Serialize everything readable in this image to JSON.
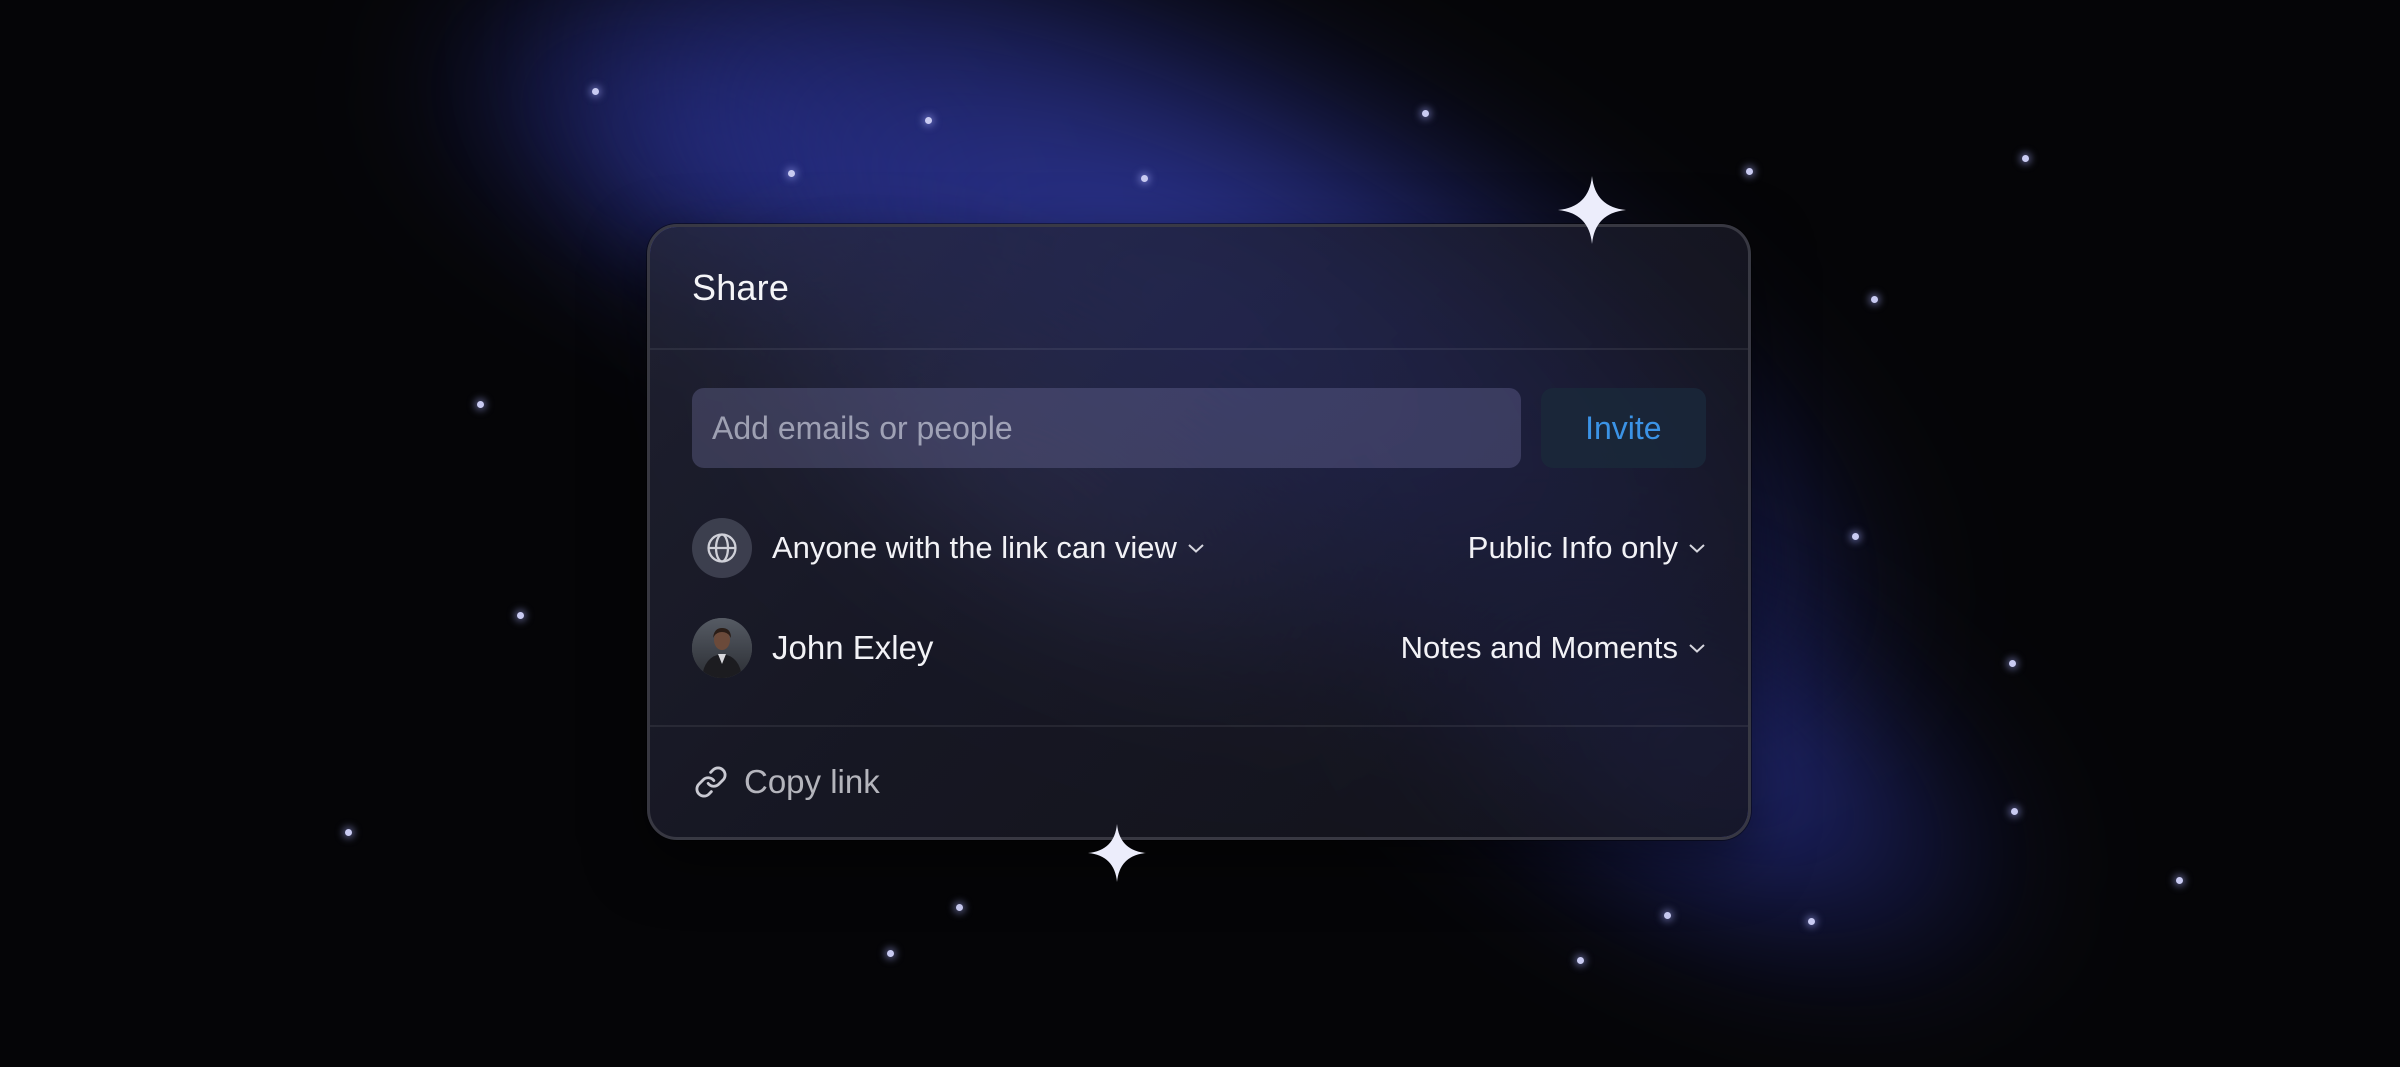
{
  "share": {
    "title": "Share",
    "email_placeholder": "Add emails or people",
    "invite_label": "Invite",
    "link_access": {
      "icon": "globe-icon",
      "label": "Anyone with the link can view",
      "scope_label": "Public Info only"
    },
    "member": {
      "icon": "avatar",
      "name": "John Exley",
      "scope_label": "Notes and Moments"
    },
    "copy_link": {
      "icon": "link-icon",
      "label": "Copy link"
    }
  },
  "colors": {
    "background": "#050507",
    "accent_blue": "#3b93e6",
    "glow_blue": "#343ea8",
    "panel_border_accent": "#5860e6"
  }
}
